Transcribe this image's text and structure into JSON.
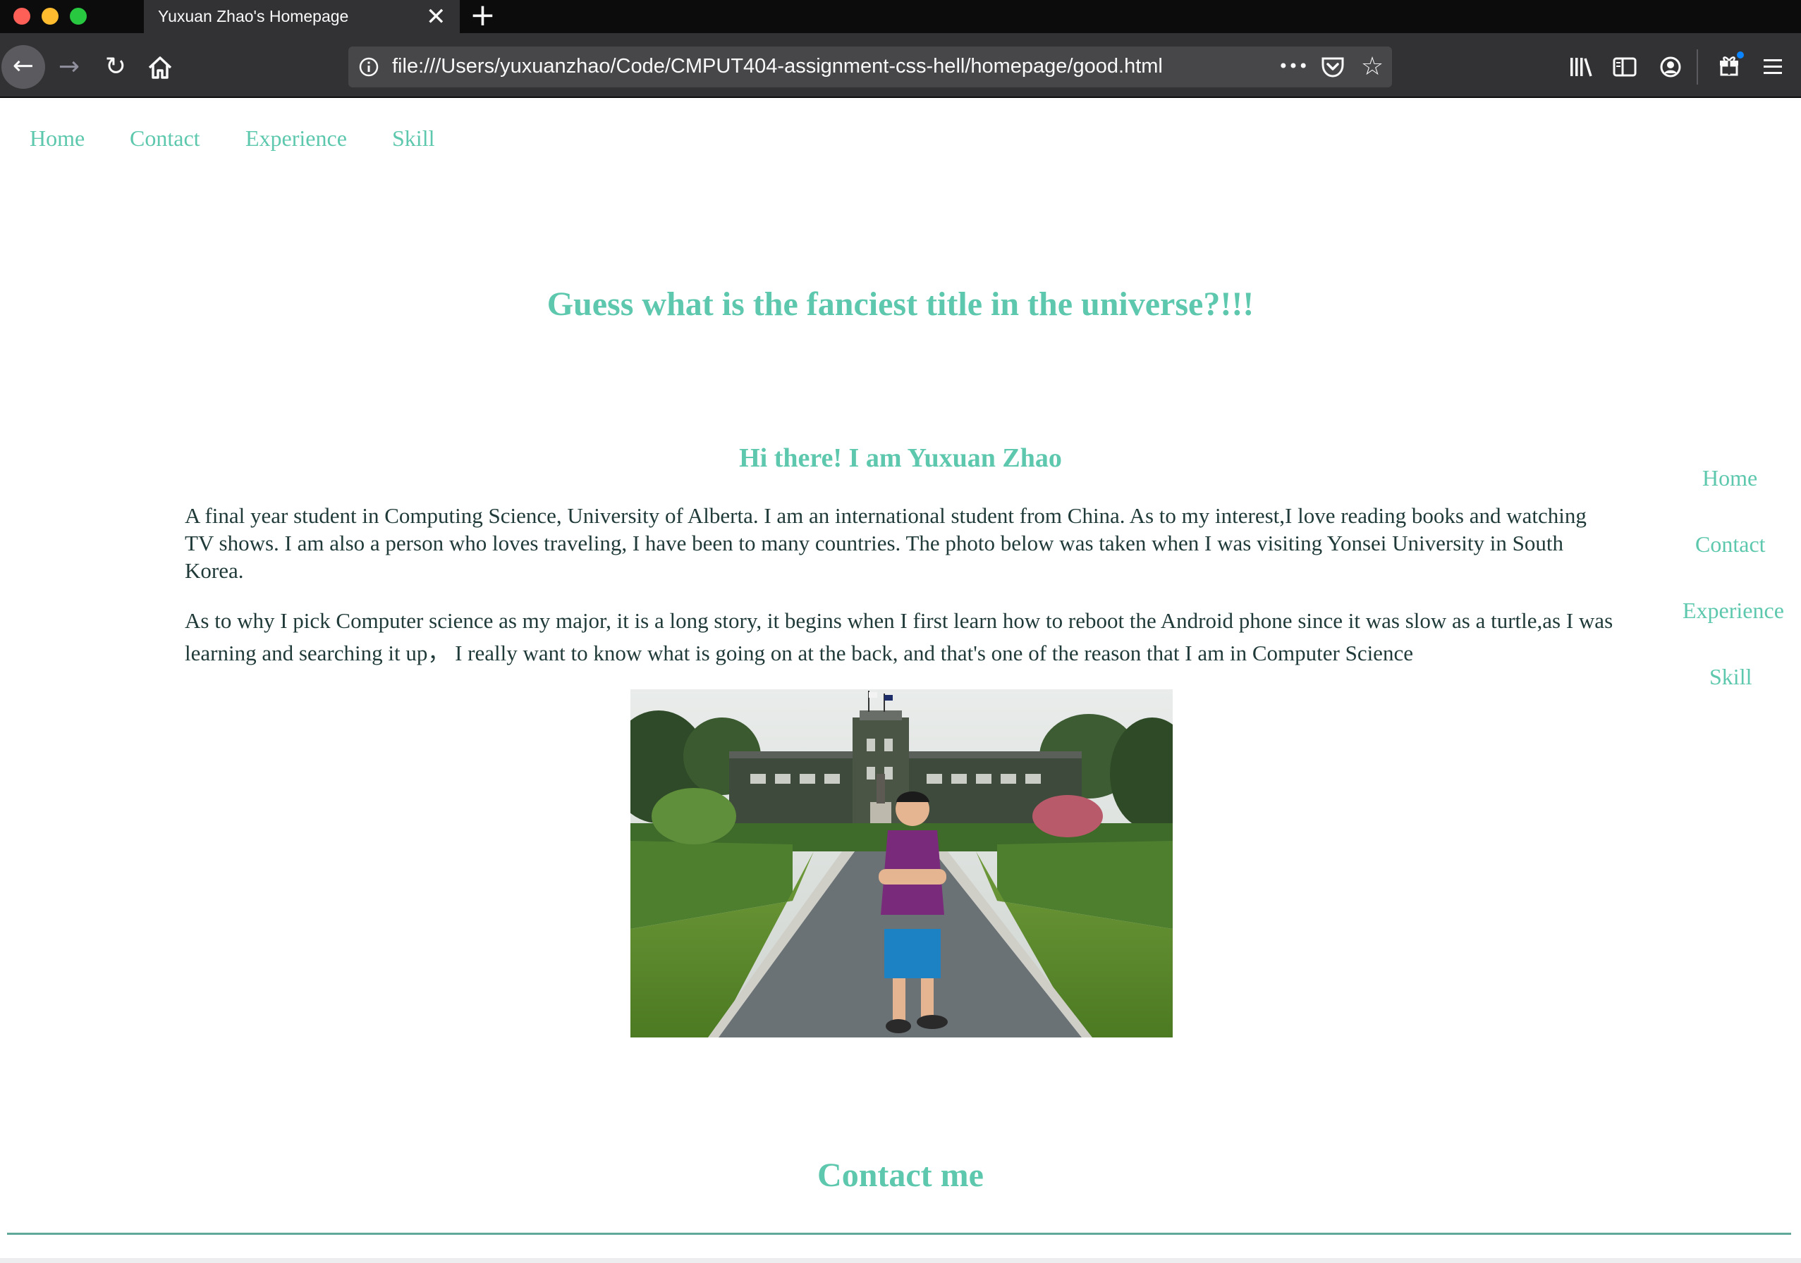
{
  "browser": {
    "tab_title": "Yuxuan Zhao's Homepage",
    "close_glyph": "✕",
    "new_tab_glyph": "+",
    "url": "file:///Users/yuxuanzhao/Code/CMPUT404-assignment-css-hell/homepage/good.html",
    "page_actions_glyph": "•••",
    "icons": [
      "back-icon",
      "forward-icon",
      "reload-icon",
      "home-icon",
      "info-icon",
      "pocket-icon",
      "bookmark-star-icon",
      "library-icon",
      "sidebar-icon",
      "account-icon",
      "gift-icon",
      "menu-icon"
    ],
    "traffic_light_colors": [
      "#fe5f57",
      "#febc2e",
      "#28c840"
    ]
  },
  "top_nav": {
    "items": [
      {
        "label": "Home"
      },
      {
        "label": "Contact"
      },
      {
        "label": "Experience"
      },
      {
        "label": "Skill"
      }
    ]
  },
  "side_nav": {
    "items": [
      {
        "label": "Home"
      },
      {
        "label": "Contact"
      },
      {
        "label": "Experience"
      },
      {
        "label": "Skill"
      }
    ]
  },
  "main": {
    "title": "Guess what is the fanciest title in the universe?!!!",
    "intro_heading": "Hi there! I am Yuxuan Zhao",
    "paragraphs": [
      "A final year student in Computing Science, University of Alberta. I am an international student from China. As to my interest,I love reading books and watching TV shows. I am also a person who loves traveling, I have been to many countries. The photo below was taken when I was visiting Yonsei University in South Korea.",
      "As to why I pick Computer science as my major, it is a long story, it begins when I first learn how to reboot the Android phone since it was slow as a turtle,as I was learning and searching it up， I really want to know what is going on at the back, and that's one of the reason that I am in Computer Science"
    ],
    "contact_heading": "Contact me"
  },
  "colors": {
    "accent": "#5dc8ad",
    "body_text": "#1f3a38",
    "rule": "#5fa89a",
    "chrome_dark": "#0c0c0d",
    "chrome_toolbar": "#323234"
  }
}
